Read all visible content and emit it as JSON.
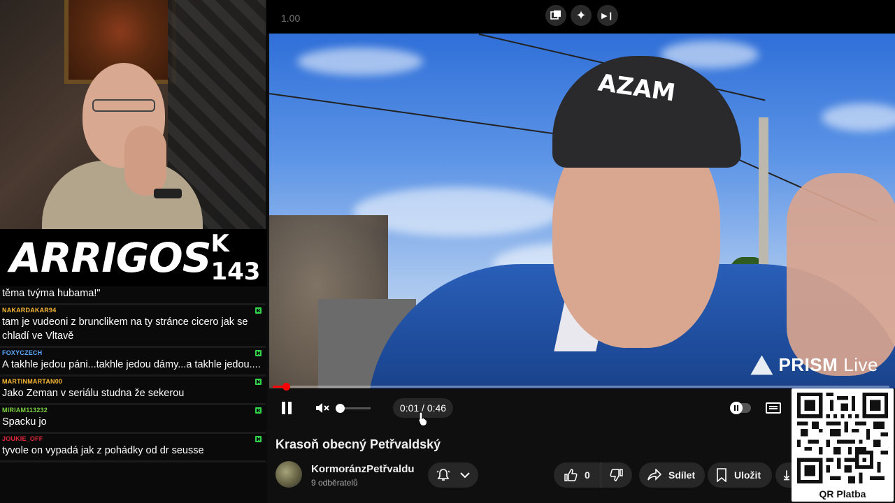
{
  "stream": {
    "brand_logo": "ARRIGOS",
    "brand_counter": "K 143"
  },
  "chat": {
    "messages": [
      {
        "user": "",
        "user_color": "#ffffff",
        "text": "těma tvýma hubama!\"",
        "badge": false
      },
      {
        "user": "NAKARDAKAR94",
        "user_color": "#f7b733",
        "text": "tam je vudeoni z brunclikem na ty stránce cicero jak se chladí ve Vltavě",
        "badge": true
      },
      {
        "user": "FOXYCZECH",
        "user_color": "#5aa9ff",
        "text": "A takhle jedou páni...takhle jedou dámy...a takhle jedou....",
        "badge": true
      },
      {
        "user": "MARTINMARTAN00",
        "user_color": "#f7b733",
        "text": "Jako Zeman v seriálu studna že sekerou",
        "badge": true
      },
      {
        "user": "MIRIAM113232",
        "user_color": "#7bd13f",
        "text": "Spacku jo",
        "badge": true
      },
      {
        "user": "JOUKIE_OFF",
        "user_color": "#e0283c",
        "text": "tyvole on vypadá jak z pohádky od dr seusse",
        "badge": true
      }
    ]
  },
  "player": {
    "speed": "1.00",
    "watermark_brand": "PRISM",
    "watermark_live": "Live",
    "cap_logo": "AZAM",
    "progress_fraction": 0.022,
    "time_current": "0:01",
    "time_separator": " / ",
    "time_total": "0:46",
    "accent_color": "#ff0000"
  },
  "video": {
    "title": "Krasoň obecný Petřvaldský",
    "channel_name": "KormoránzPetřvaldu",
    "subscribers": "9 odběratelů",
    "like_count": "0",
    "share_label": "Sdílet",
    "save_label": "Uložit"
  },
  "qr": {
    "label": "QR Platba"
  },
  "icons": {
    "pip": "picture-in-picture-icon",
    "effects": "sparkle-icon",
    "next": "skip-next-icon"
  }
}
